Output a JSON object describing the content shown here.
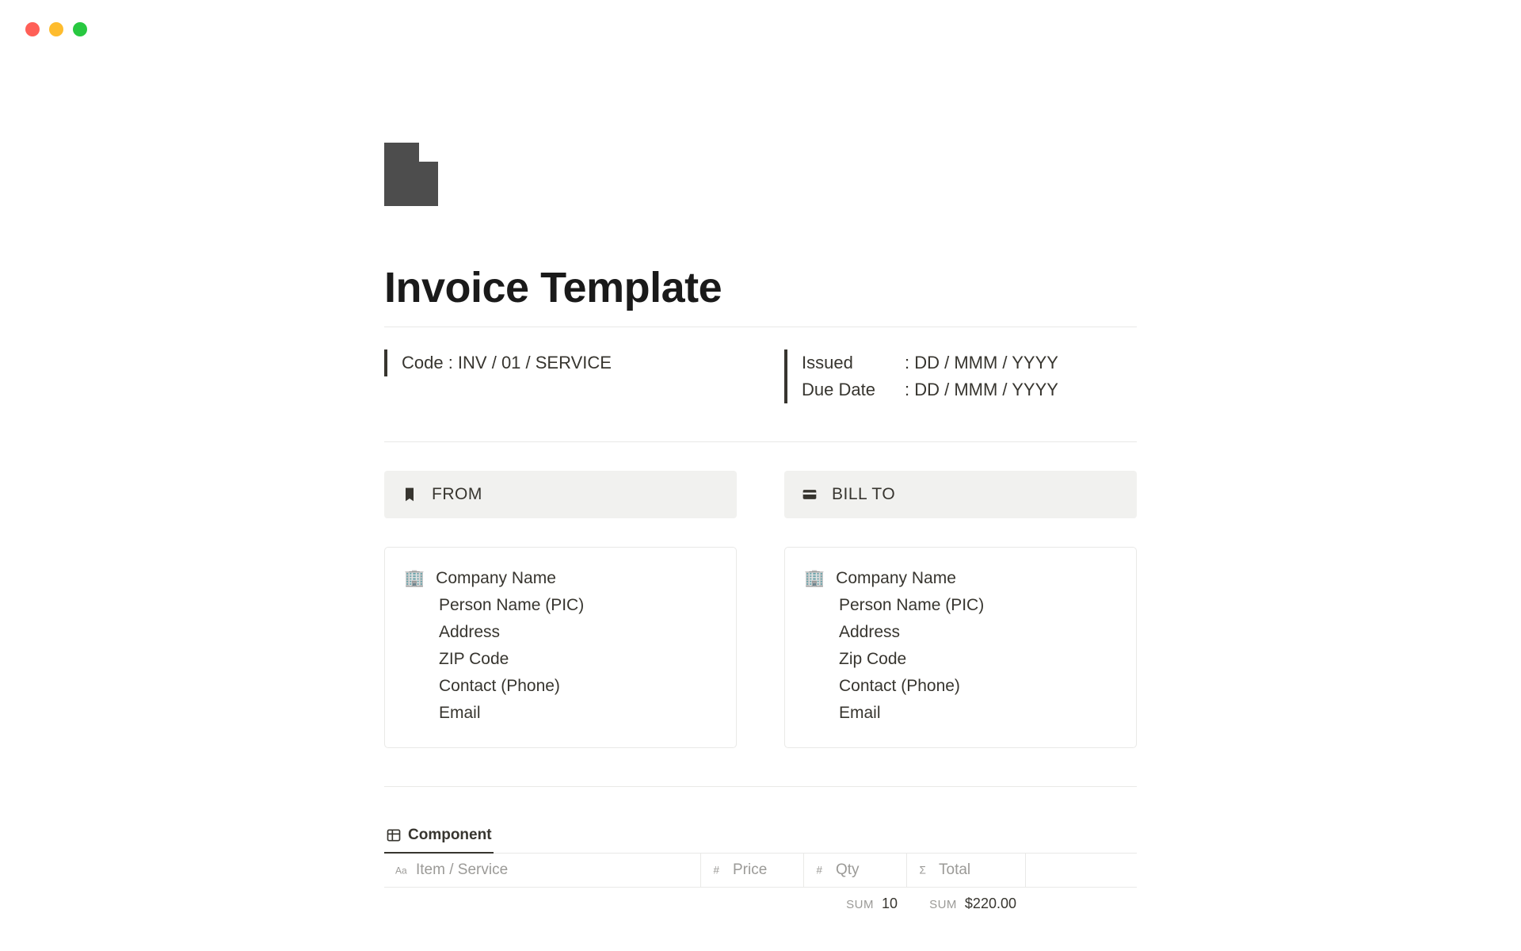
{
  "title": "Invoice Template",
  "meta": {
    "code_line": "Code : INV / 01 / SERVICE",
    "issued_label": "Issued",
    "issued_value": ": DD / MMM / YYYY",
    "due_label": "Due Date",
    "due_value": ": DD / MMM / YYYY"
  },
  "from": {
    "heading": "FROM",
    "lines": {
      "company": "Company Name",
      "person": "Person Name (PIC)",
      "address": "Address",
      "zip": "ZIP Code",
      "contact": "Contact (Phone)",
      "email": "Email"
    }
  },
  "bill_to": {
    "heading": "BILL TO",
    "lines": {
      "company": "Company Name",
      "person": "Person Name (PIC)",
      "address": "Address",
      "zip": "Zip Code",
      "contact": "Contact (Phone)",
      "email": "Email"
    }
  },
  "database": {
    "tab": "Component",
    "columns": {
      "item": "Item / Service",
      "price": "Price",
      "qty": "Qty",
      "total": "Total"
    },
    "sums": {
      "label": "SUM",
      "qty": "10",
      "total": "$220.00"
    }
  }
}
